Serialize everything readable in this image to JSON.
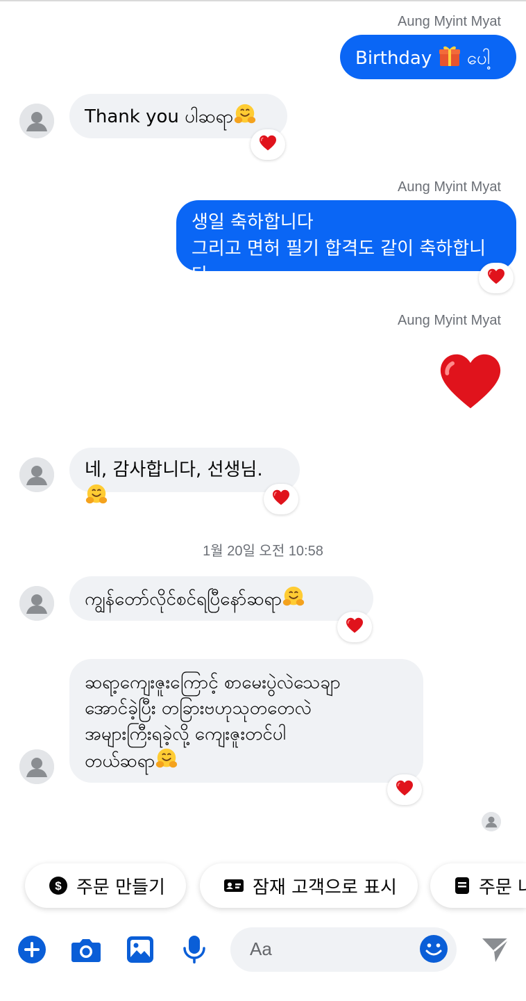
{
  "thread": {
    "messages": [
      {
        "sender": "Aung Myint Myat",
        "text": "Birthday",
        "text_after_emoji": "ပေါ့",
        "emoji": "gift-icon"
      },
      {
        "text": "Thank you ပါဆရာ",
        "emoji": "hugging-face-icon",
        "reaction": "heart-icon"
      },
      {
        "sender": "Aung Myint Myat",
        "text": "생일 축하합니다\n그리고 면허 필기 합격도 같이 축하합니다",
        "reaction": "heart-icon"
      },
      {
        "sender": "Aung Myint Myat",
        "emoji": "large-heart-icon"
      },
      {
        "text": "네, 감사합니다, 선생님.",
        "emoji": "hugging-face-icon",
        "reaction": "heart-icon"
      },
      {
        "text": "ကျွန်တော်လိုင်စင်ရပြီနော်ဆရာ",
        "emoji": "hugging-face-icon",
        "reaction": "heart-icon"
      },
      {
        "text": "ဆရာ့ကျေးဇူးကြောင့် စာမေးပွဲလဲသေချာ\nအောင်ခဲ့ပြီး တခြားဗဟုသုတတေလဲ\nအများကြီးရခဲ့လို့ ကျေးဇူးတင်ပါ\nတယ်ဆရာ",
        "emoji": "hugging-face-icon",
        "reaction": "heart-icon"
      }
    ],
    "timestamp": "1월 20일 오전 10:58"
  },
  "quick_actions": [
    {
      "label": "주문 만들기",
      "icon": "dollar-circle-icon"
    },
    {
      "label": "잠재 고객으로 표시",
      "icon": "contact-card-icon"
    },
    {
      "label": "주문 나",
      "icon": "document-icon"
    }
  ],
  "composer": {
    "placeholder": "Aa",
    "buttons": [
      "plus-icon",
      "camera-icon",
      "image-icon",
      "microphone-icon",
      "emoji-icon",
      "send-icon"
    ]
  },
  "colors": {
    "outgoing_bubble": "#0a66f5",
    "incoming_bubble": "#f0f2f5",
    "accent": "#0a5ed7",
    "heart": "#e0131c"
  }
}
